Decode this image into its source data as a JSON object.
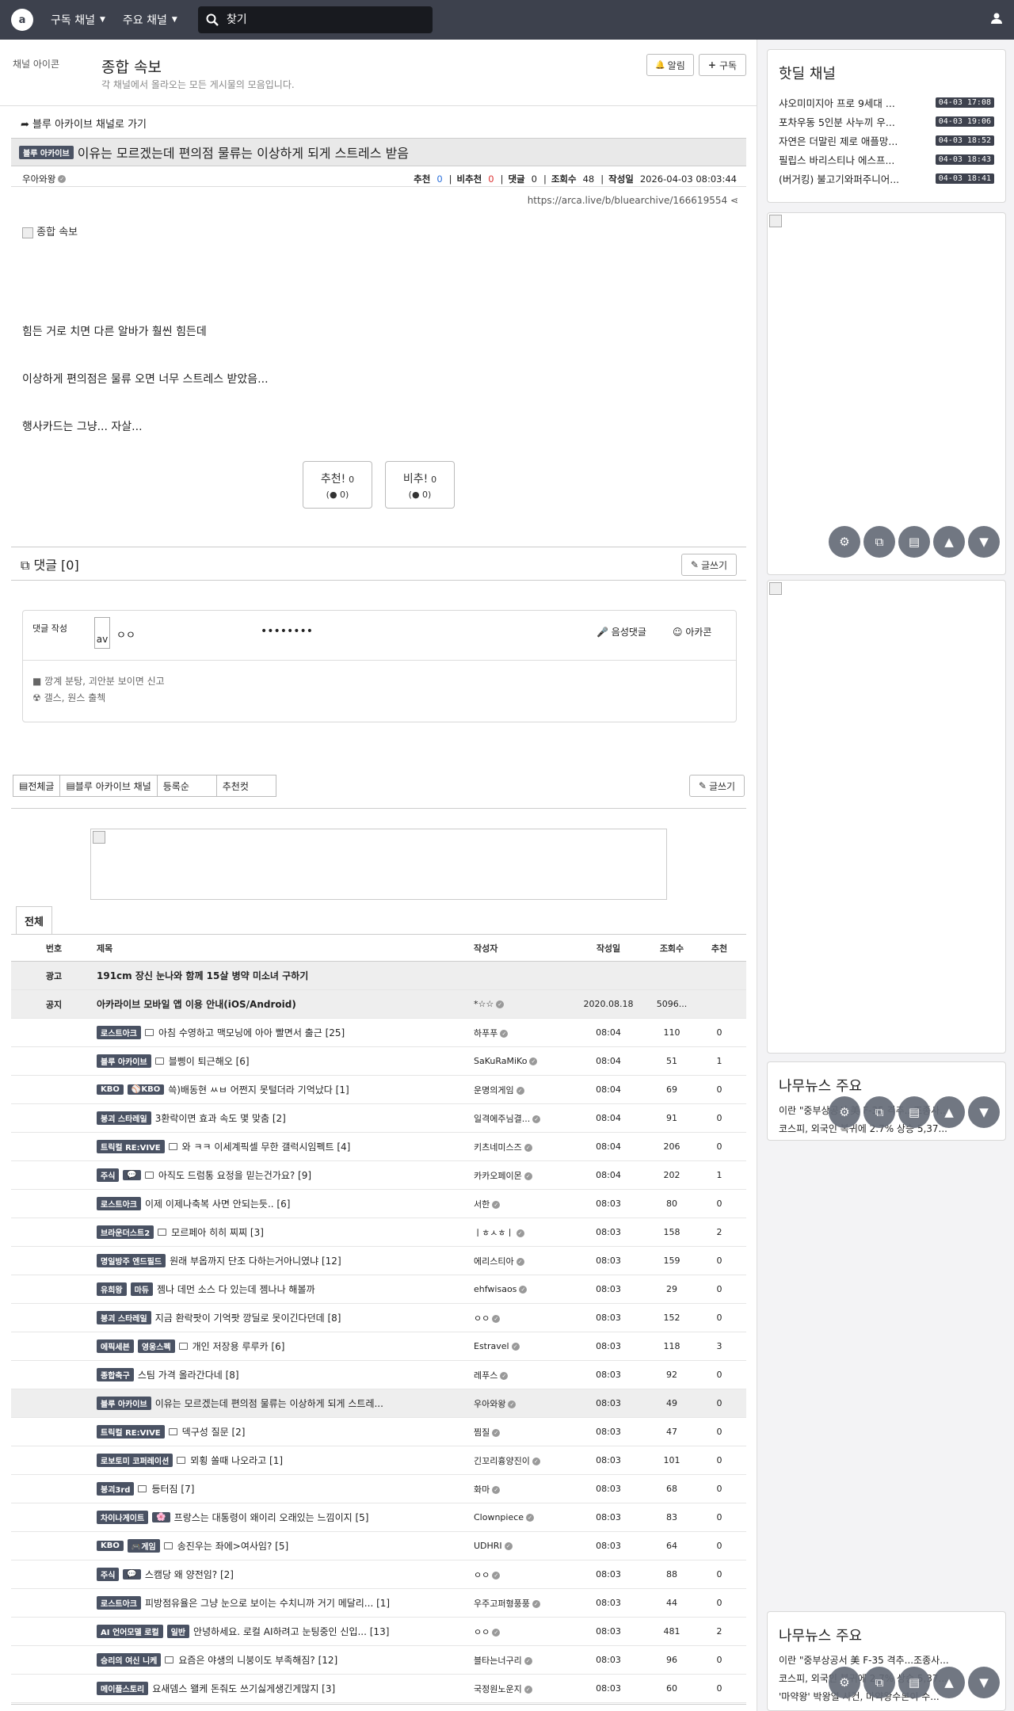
{
  "nav": {
    "subscribed": "구독 채널",
    "main": "주요 채널",
    "search_placeholder": "찾기"
  },
  "header": {
    "icon_alt": "채널 아이콘",
    "title": "종합 속보",
    "desc": "각 채널에서 올라오는 모든 게시물의 모음입니다.",
    "notify": "알림",
    "subscribe": "구독"
  },
  "post": {
    "back": "블루 아카이브 채널로 가기",
    "badge": "블루 아카이브",
    "title": "이유는 모르겠는데 편의점 물류는 이상하게 되게 스트레스 받음",
    "author": "우아와왕",
    "rec_label": "추천",
    "rec": "0",
    "unrec_label": "비추천",
    "unrec": "0",
    "cmt_label": "댓글",
    "cmt": "0",
    "views_label": "조회수",
    "views": "48",
    "date_label": "작성일",
    "date": "2026-04-03 08:03:44",
    "url": "https://arca.live/b/bluearchive/166619554",
    "img_alt": "종합 속보",
    "p1": "힘든 거로 치면 다른 알바가 훨씬 힘든데",
    "p2": "이상하게 편의점은 물류 오면 너무 스트레스 받았음...",
    "p3": "행사카드는 그냥... 자살...",
    "upvote": "추천!",
    "upvote_n": "0",
    "upvote_sub": "0",
    "downvote": "비추!",
    "downvote_n": "0",
    "downvote_sub": "0"
  },
  "comments": {
    "title": "댓글 [0]",
    "write": "글쓰기",
    "form_label": "댓글 작성",
    "avatar": "av",
    "nick": "ㅇㅇ",
    "password": "••••••••",
    "voice": "음성댓글",
    "arcacon": "아카콘",
    "rule1": "깡계 분탕, 괴안분 보이면 신고",
    "rule2": "갤스, 원스 출첵"
  },
  "tabs": {
    "all": "전체글",
    "channel": "블루 아카이브 채널",
    "sort": "등록순",
    "best": "추천컷",
    "write": "글쓰기",
    "tab_all": "전체"
  },
  "table": {
    "headers": [
      "번호",
      "제목",
      "작성자",
      "작성일",
      "조회수",
      "추천"
    ],
    "rows": [
      {
        "no": "광고",
        "title": "191cm 장신 눈나와 함께 15살 병약 미소녀 구하기",
        "author": "",
        "date": "",
        "views": "",
        "rec": "",
        "kind": "ad"
      },
      {
        "no": "공지",
        "title": "아카라이브 모바일 앱 이용 안내(iOS/Android)",
        "author": "*☆☆",
        "date": "2020.08.18",
        "views": "5096...",
        "rec": "",
        "kind": "notice"
      },
      {
        "no": "",
        "b1": "로스트아크",
        "title": "아침 수영하고 맥모닝에 아아 빨면서 출근 [25]",
        "author": "하푸푸",
        "date": "08:04",
        "views": "110",
        "rec": "0",
        "doc": true
      },
      {
        "no": "",
        "b1": "블루 아카이브",
        "title": "블삥이 퇴근해오 [6]",
        "author": "SaKuRaMiKo",
        "date": "08:04",
        "views": "51",
        "rec": "1",
        "doc": true
      },
      {
        "no": "",
        "b1": "KBO",
        "b2": "⚾KBO",
        "title": "쓱)배동현 ㅆㅂ 어쩐지 못털더라 기억났다 [1]",
        "author": "운명의게임",
        "date": "08:04",
        "views": "69",
        "rec": "0"
      },
      {
        "no": "",
        "b1": "붕괴 스타레일",
        "title": "3환락이면 효과 속도 몇 맞춤 [2]",
        "author": "일격에주님결...",
        "date": "08:04",
        "views": "91",
        "rec": "0"
      },
      {
        "no": "",
        "b1": "트릭컬 RE:VIVE",
        "title": "와 ㅋㅋ 이세계픽셀 무한 갤럭시임펙트 [4]",
        "author": "키츠네미스즈",
        "date": "08:04",
        "views": "206",
        "rec": "0",
        "doc": true
      },
      {
        "no": "",
        "b1": "주식",
        "b2": "💬",
        "title": "아직도 드럼통 요정을 믿는건가요? [9]",
        "author": "카카오페이몬",
        "date": "08:04",
        "views": "202",
        "rec": "1",
        "doc": true
      },
      {
        "no": "",
        "b1": "로스트아크",
        "title": "이제 이제나축복 사면 안되는듯.. [6]",
        "author": "서한",
        "date": "08:03",
        "views": "80",
        "rec": "0"
      },
      {
        "no": "",
        "b1": "브라운더스트2",
        "title": "모르페아 히히 찌찌 [3]",
        "author": "ㅣㅎㅅㅎㅣ",
        "date": "08:03",
        "views": "158",
        "rec": "2",
        "doc": true
      },
      {
        "no": "",
        "b1": "명일방주 엔드필드",
        "title": "원래 부옵까지 단조 다하는거아니였냐 [12]",
        "author": "에리스티아",
        "date": "08:03",
        "views": "159",
        "rec": "0"
      },
      {
        "no": "",
        "b1": "유희왕",
        "b2": "마듀",
        "title": "젬나 데먼 소스 다 있는데 젬나나 해볼까",
        "author": "ehfwisaos",
        "date": "08:03",
        "views": "29",
        "rec": "0"
      },
      {
        "no": "",
        "b1": "붕괴 스타레일",
        "title": "지금 환락팟이 기억팟 깡딜로 못이긴다던데 [8]",
        "author": "ㅇㅇ",
        "date": "08:03",
        "views": "152",
        "rec": "0"
      },
      {
        "no": "",
        "b1": "에픽세븐",
        "b2": "영웅스펙",
        "title": "개인 저장용 루루카 [6]",
        "author": "Estravel",
        "date": "08:03",
        "views": "118",
        "rec": "3",
        "doc": true
      },
      {
        "no": "",
        "b1": "종합축구",
        "title": "스팀 가격 올라간다네 [8]",
        "author": "레푸스",
        "date": "08:03",
        "views": "92",
        "rec": "0"
      },
      {
        "no": "",
        "b1": "블루 아카이브",
        "title": "이유는 모르겠는데 편의점 물류는 이상하게 되게 스트레...",
        "author": "우아와왕",
        "date": "08:03",
        "views": "49",
        "rec": "0",
        "current": true
      },
      {
        "no": "",
        "b1": "트릭컬 RE:VIVE",
        "title": "덱구성 질문 [2]",
        "author": "찜질",
        "date": "08:03",
        "views": "47",
        "rec": "0",
        "doc": true
      },
      {
        "no": "",
        "b1": "로보토미 코퍼레이션",
        "title": "뫼횡 쏠때 나오라고 [1]",
        "author": "긴꼬리흉양진이",
        "date": "08:03",
        "views": "101",
        "rec": "0",
        "doc": true
      },
      {
        "no": "",
        "b1": "붕괴3rd",
        "title": "등터짐 [7]",
        "author": "화마",
        "date": "08:03",
        "views": "68",
        "rec": "0",
        "doc": true
      },
      {
        "no": "",
        "b1": "차이나게이트",
        "b2": "🌸",
        "title": "프랑스는 대통령이 왜이리 오래있는 느낌이지 [5]",
        "author": "Clownpiece",
        "date": "08:03",
        "views": "83",
        "rec": "0"
      },
      {
        "no": "",
        "b1": "KBO",
        "b2": "🎮게임",
        "title": "송진우는 좌에>여사임? [5]",
        "author": "UDHRI",
        "date": "08:03",
        "views": "64",
        "rec": "0",
        "doc": true
      },
      {
        "no": "",
        "b1": "주식",
        "b2": "💬",
        "title": "스캠당 왜 양전임? [2]",
        "author": "ㅇㅇ",
        "date": "08:03",
        "views": "88",
        "rec": "0"
      },
      {
        "no": "",
        "b1": "로스트아크",
        "title": "피방점유율은 그냥 눈으로 보이는 수치니까 거기 메달리... [1]",
        "author": "우주고퍼형풍풍",
        "date": "08:03",
        "views": "44",
        "rec": "0"
      },
      {
        "no": "",
        "b1": "AI 언어모델 로컬",
        "b2": "일반",
        "title": "안녕하세요. 로컬 AI하려고 눈팅중인 신입... [13]",
        "author": "ㅇㅇ",
        "date": "08:03",
        "views": "481",
        "rec": "2"
      },
      {
        "no": "",
        "b1": "승리의 여신 니케",
        "title": "요즘은 야생의 니붕이도 부족해짐? [12]",
        "author": "블타는너구리",
        "date": "08:03",
        "views": "96",
        "rec": "0",
        "doc": true
      },
      {
        "no": "",
        "b1": "메이플스토리",
        "title": "요새뎀스 왤케 돈줘도 쓰기싫게생긴게많지 [3]",
        "author": "국정원노운지",
        "date": "08:03",
        "views": "60",
        "rec": "0"
      }
    ]
  },
  "sidebar": {
    "hot_title": "핫딜 채널",
    "hot": [
      {
        "t": "샤오미미지아 프로 9세대 ...",
        "time": "04-03 17:08"
      },
      {
        "t": "포차우동 5인분 사누끼 우...",
        "time": "04-03 19:06"
      },
      {
        "t": "자연은 더말린 제로 애플망...",
        "time": "04-03 18:52"
      },
      {
        "t": "필립스 바리스티나 에스프...",
        "time": "04-03 18:43"
      },
      {
        "t": "(버거킹) 불고기와퍼주니어...",
        "time": "04-03 18:41"
      }
    ],
    "news_title": "나무뉴스 주요",
    "news1": "이란 \"중부상공서 美 F-35 격추...조종사...",
    "news2": "코스피, 외국인 복귀에 2.7% 상승 5,37...",
    "news_title2": "나무뉴스 주요",
    "news2_1": "이란 \"중부상공서 美 F-35 격추...조종사...",
    "news2_2": "코스피, 외국인 복귀에 2.7% 상승 5,37...",
    "news2_3": "'마약왕' 박왕열 사건, 마약왕수본이 수..."
  }
}
